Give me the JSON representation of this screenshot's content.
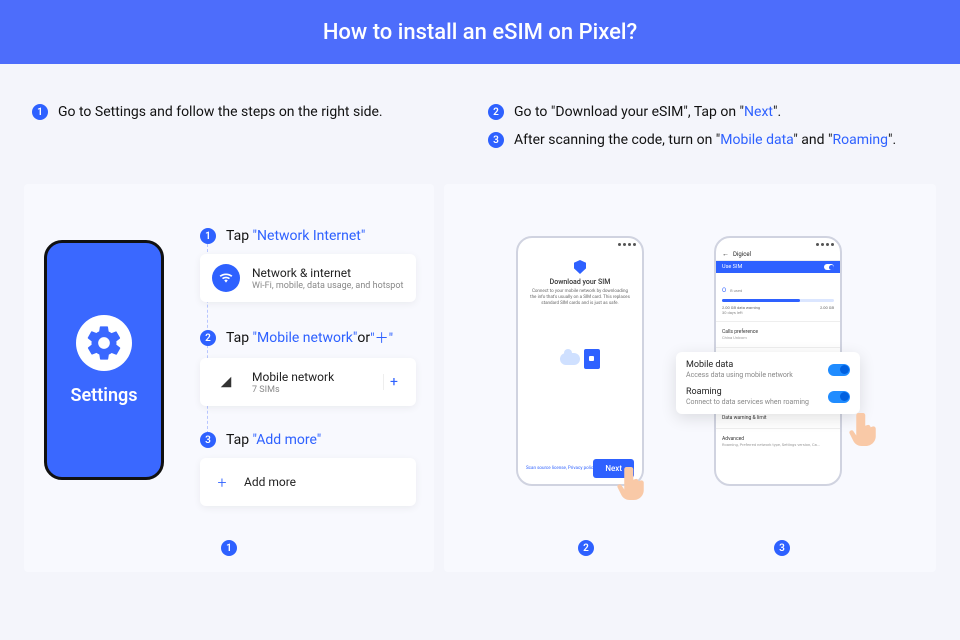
{
  "banner": {
    "title": "How to install an eSIM on Pixel?"
  },
  "top": {
    "left": {
      "num": "1",
      "text": "Go to Settings and follow the steps on the right side."
    },
    "right2": {
      "num": "2",
      "pre": "Go to \"Download your eSIM\", Tap on \"",
      "em": "Next",
      "post": "\"."
    },
    "right3": {
      "num": "3",
      "pre": "After scanning the code, turn on \"",
      "em1": "Mobile data",
      "mid": "\" and \"",
      "em2": "Roaming",
      "post": "\"."
    }
  },
  "device": {
    "label": "Settings"
  },
  "taps": {
    "t1": {
      "num": "1",
      "pre": "Tap ",
      "em": "\"Network Internet\"",
      "card_title": "Network & internet",
      "card_sub": "Wi-Fi, mobile, data usage, and hotspot"
    },
    "t2": {
      "num": "2",
      "pre": "Tap ",
      "em": "\"Mobile network\"",
      "mid": " or ",
      "em2": "\"＋\"",
      "card_title": "Mobile network",
      "card_sub": "7 SIMs",
      "plus": "+"
    },
    "t3": {
      "num": "3",
      "pre": "Tap ",
      "em": "\"Add more\"",
      "card_title": "Add more",
      "plus": "+"
    }
  },
  "panel_left_badge": "1",
  "phone2": {
    "title": "Download your SIM",
    "desc": "Connect to your mobile network by downloading the info that's usually on a SIM card. This replaces standard SIM cards and is just as safe.",
    "foot_links": "Scan source license, Privacy polic",
    "next": "Next"
  },
  "phone3": {
    "carrier": "Digicel",
    "use_sim": "Use SIM",
    "usage_val": "O",
    "usage_unit": "B used",
    "warn": "2.00 GB data warning",
    "days": "30 days left",
    "limit": "2.00 GB",
    "callpref": "Calls preference",
    "callpref_sub": "China Unicom",
    "datawarn": "Data warning & limit",
    "adv": "Advanced",
    "adv_sub": "Roaming, Preferred network type, Settings version, Ca..."
  },
  "overlay": {
    "md_t": "Mobile data",
    "md_s": "Access data using mobile network",
    "rm_t": "Roaming",
    "rm_s": "Connect to data services when roaming"
  },
  "badge2": "2",
  "badge3": "3"
}
